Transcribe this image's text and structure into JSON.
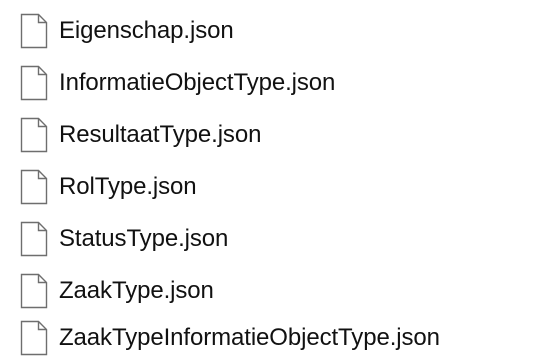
{
  "files": [
    {
      "name": "Eigenschap.json",
      "icon": "file-icon"
    },
    {
      "name": "InformatieObjectType.json",
      "icon": "file-icon"
    },
    {
      "name": "ResultaatType.json",
      "icon": "file-icon"
    },
    {
      "name": "RolType.json",
      "icon": "file-icon"
    },
    {
      "name": "StatusType.json",
      "icon": "file-icon"
    },
    {
      "name": "ZaakType.json",
      "icon": "file-icon"
    },
    {
      "name": "ZaakTypeInformatieObjectType.json",
      "icon": "file-icon"
    }
  ],
  "colors": {
    "background": "#ffffff",
    "text": "#111111",
    "icon_outline": "#6e6e6e",
    "icon_fill": "#ffffff"
  }
}
